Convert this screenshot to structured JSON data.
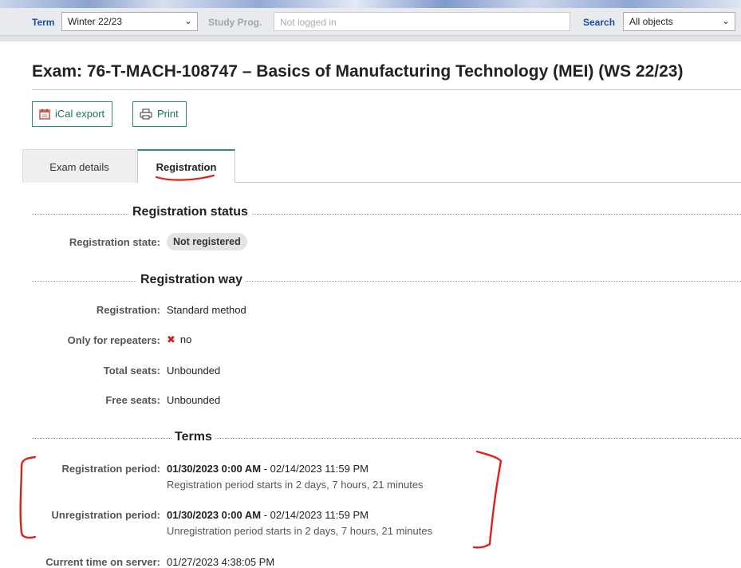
{
  "search_bar": {
    "term_label": "Term",
    "term_value": "Winter 22/23",
    "study_prog_label": "Study Prog.",
    "study_prog_placeholder": "Not logged in",
    "search_label": "Search",
    "search_value": "All objects"
  },
  "page_title": "Exam: 76-T-MACH-108747 – Basics of Manufacturing Technology (MEI) (WS 22/23)",
  "toolbar": {
    "ical_label": "iCal export",
    "print_label": "Print"
  },
  "tabs": [
    {
      "label": "Exam details",
      "active": false
    },
    {
      "label": "Registration",
      "active": true
    }
  ],
  "registration_status": {
    "title": "Registration status",
    "state_label": "Registration state:",
    "state_value": "Not registered"
  },
  "registration_way": {
    "title": "Registration way",
    "rows": [
      {
        "label": "Registration:",
        "value": "Standard method"
      },
      {
        "label": "Only for repeaters:",
        "value": "no"
      },
      {
        "label": "Total seats:",
        "value": "Unbounded"
      },
      {
        "label": "Free seats:",
        "value": "Unbounded"
      }
    ]
  },
  "terms": {
    "title": "Terms",
    "registration_period": {
      "label": "Registration period:",
      "start": "01/30/2023 0:00 AM",
      "end": " - 02/14/2023 11:59 PM",
      "note": "Registration period starts in 2 days, 7 hours, 21 minutes"
    },
    "unregistration_period": {
      "label": "Unregistration period:",
      "start": "01/30/2023 0:00 AM",
      "end": " - 02/14/2023 11:59 PM",
      "note": "Unregistration period starts in 2 days, 7 hours, 21 minutes"
    },
    "server_time_label": "Current time on server:",
    "server_time_value": "01/27/2023 4:38:05 PM"
  },
  "colors": {
    "accent": "#2f8c7f",
    "link_blue": "#1a4f9c",
    "annotation_red": "#e0201b"
  }
}
